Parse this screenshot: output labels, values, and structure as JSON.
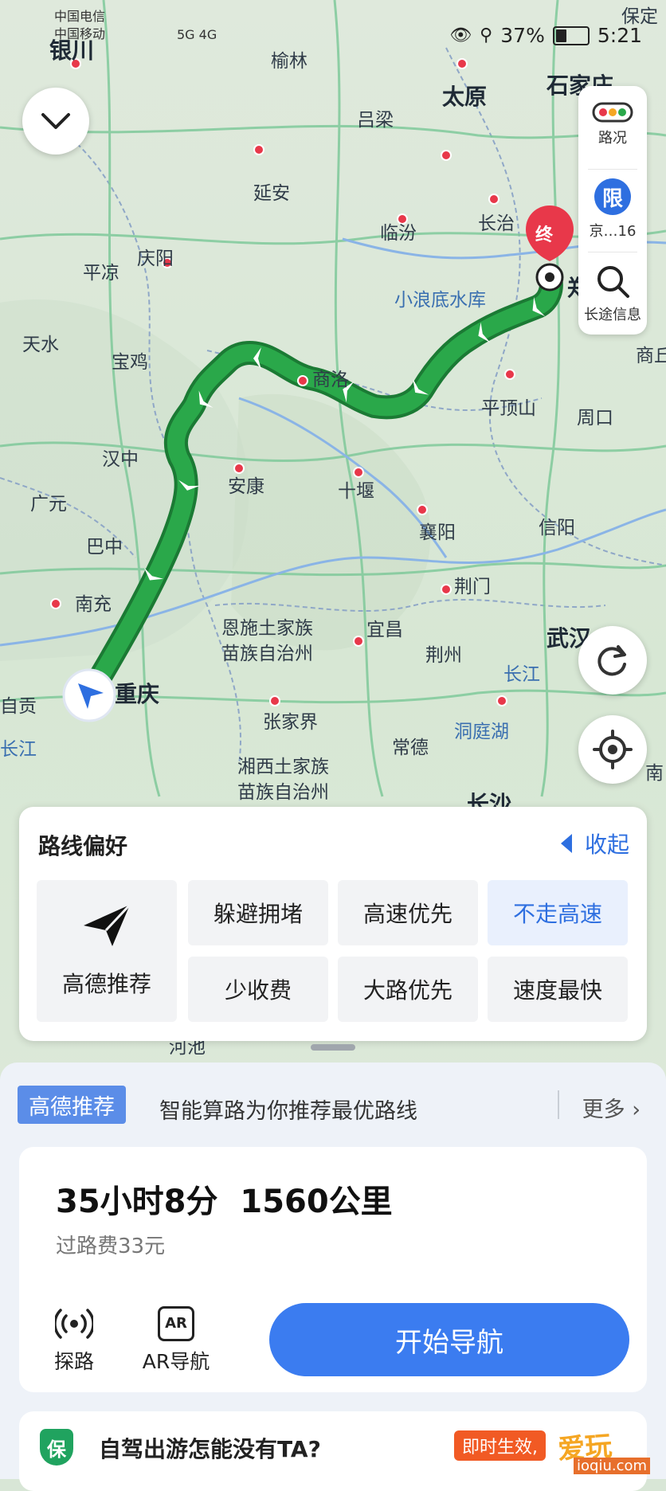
{
  "status_bar": {
    "carrier1": "中国电信",
    "carrier2": "中国移动",
    "signal_info": "5G  4G",
    "battery": "37%",
    "battery_level": 0.37,
    "time": "5:21"
  },
  "map": {
    "cities": [
      {
        "name": "银川",
        "cls": "big"
      },
      {
        "name": "榆林",
        "cls": ""
      },
      {
        "name": "太原",
        "cls": "big"
      },
      {
        "name": "石家庄",
        "cls": "big"
      },
      {
        "name": "保定",
        "cls": ""
      },
      {
        "name": "吕梁",
        "cls": ""
      },
      {
        "name": "延安",
        "cls": ""
      },
      {
        "name": "临汾",
        "cls": ""
      },
      {
        "name": "长治",
        "cls": ""
      },
      {
        "name": "庆阳",
        "cls": ""
      },
      {
        "name": "平凉",
        "cls": ""
      },
      {
        "name": "小浪底水库",
        "cls": "water"
      },
      {
        "name": "郑州",
        "cls": "big"
      },
      {
        "name": "天水",
        "cls": ""
      },
      {
        "name": "宝鸡",
        "cls": ""
      },
      {
        "name": "商洛",
        "cls": ""
      },
      {
        "name": "平顶山",
        "cls": ""
      },
      {
        "name": "周口",
        "cls": ""
      },
      {
        "name": "商丘",
        "cls": ""
      },
      {
        "name": "汉中",
        "cls": ""
      },
      {
        "name": "安康",
        "cls": ""
      },
      {
        "name": "十堰",
        "cls": ""
      },
      {
        "name": "广元",
        "cls": ""
      },
      {
        "name": "襄阳",
        "cls": ""
      },
      {
        "name": "信阳",
        "cls": ""
      },
      {
        "name": "巴中",
        "cls": ""
      },
      {
        "name": "荆门",
        "cls": ""
      },
      {
        "name": "南充",
        "cls": ""
      },
      {
        "name": "恩施土家族",
        "cls": ""
      },
      {
        "name": "苗族自治州",
        "cls": ""
      },
      {
        "name": "宜昌",
        "cls": ""
      },
      {
        "name": "荆州",
        "cls": ""
      },
      {
        "name": "武汉",
        "cls": "big"
      },
      {
        "name": "重庆",
        "cls": "big"
      },
      {
        "name": "长江",
        "cls": "water"
      },
      {
        "name": "自贡",
        "cls": ""
      },
      {
        "name": "长江",
        "cls": "water"
      },
      {
        "name": "张家界",
        "cls": ""
      },
      {
        "name": "洞庭湖",
        "cls": "water"
      },
      {
        "name": "常德",
        "cls": ""
      },
      {
        "name": "湘西土家族",
        "cls": ""
      },
      {
        "name": "苗族自治州",
        "cls": ""
      },
      {
        "name": "长沙",
        "cls": "big"
      },
      {
        "name": "南",
        "cls": ""
      },
      {
        "name": "河池",
        "cls": ""
      }
    ],
    "end_marker": "终",
    "route_color": "#2aa84a",
    "route_outline": "#1b7a34"
  },
  "right_panel": {
    "traffic_label": "路况",
    "limit_badge": "限",
    "limit_label": "京…16",
    "search_label": "长途信息"
  },
  "preferences": {
    "title": "路线偏好",
    "collapse_label": "收起",
    "main_option": "高德推荐",
    "options": [
      "躲避拥堵",
      "高速优先",
      "不走高速",
      "少收费",
      "大路优先",
      "速度最快"
    ]
  },
  "recommendation": {
    "badge": "高德推荐",
    "text": "智能算路为你推荐最优路线",
    "more": "更多"
  },
  "route": {
    "duration": "35小时8分",
    "distance": "1560公里",
    "toll": "过路费33元",
    "explore_label": "探路",
    "ar_icon": "AR",
    "ar_label": "AR导航",
    "start_button": "开始导航"
  },
  "ad": {
    "icon": "保",
    "text": "自驾出游怎能没有TA?",
    "badge": "即时生效,"
  },
  "watermark": {
    "text": "爱玩",
    "sub": "ioqiu.com"
  },
  "colors": {
    "accent": "#3b7cf0",
    "route": "#2aa84a",
    "end_marker": "#e8384a",
    "rec_badge": "#5b8de8"
  }
}
